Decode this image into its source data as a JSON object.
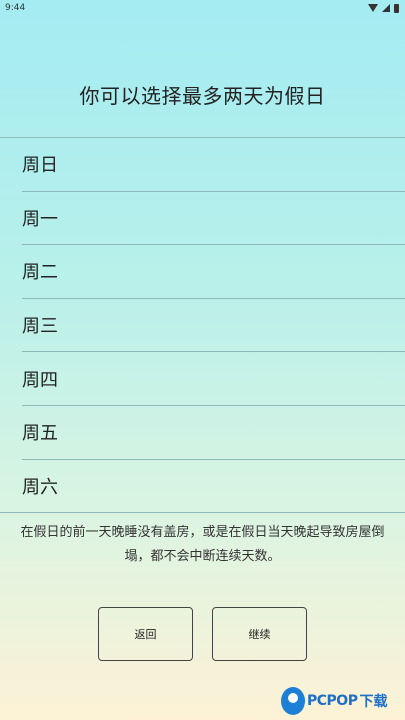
{
  "status_bar": {
    "time": "9:44"
  },
  "title": "你可以选择最多两天为假日",
  "days": [
    "周日",
    "周一",
    "周二",
    "周三",
    "周四",
    "周五",
    "周六"
  ],
  "note": "在假日的前一天晚睡没有盖房，或是在假日当天晚起导致房屋倒塌，都不会中断连续天数。",
  "buttons": {
    "back": "返回",
    "continue": "继续"
  },
  "watermark": {
    "brand": "PCPOP",
    "suffix": "下载"
  }
}
